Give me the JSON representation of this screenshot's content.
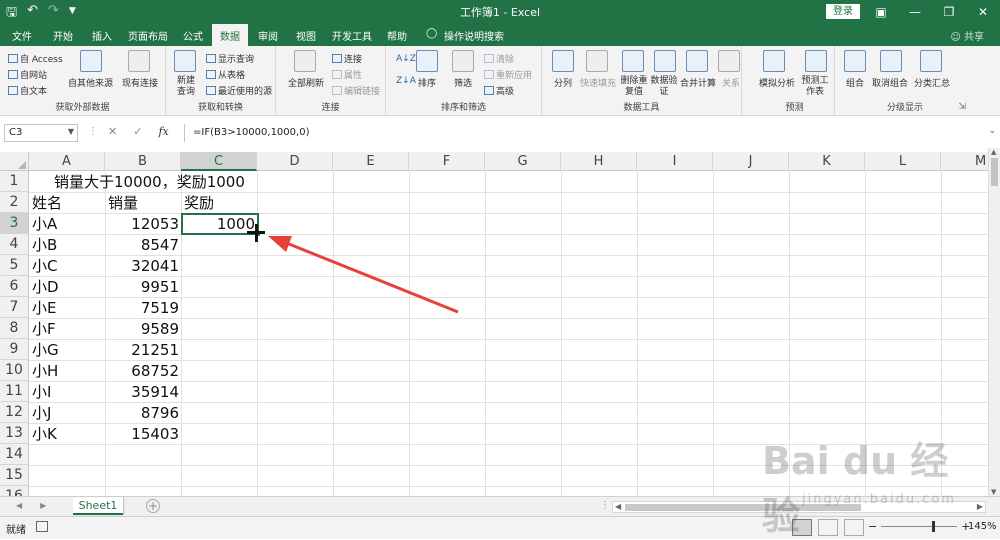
{
  "window": {
    "title": "工作簿1  -  Excel",
    "login": "登录",
    "qat": [
      "save-icon",
      "undo-icon",
      "redo-icon",
      "customize-icon"
    ]
  },
  "menu": {
    "tabs": [
      "文件",
      "开始",
      "插入",
      "页面布局",
      "公式",
      "数据",
      "审阅",
      "视图",
      "开发工具",
      "帮助"
    ],
    "active": "数据",
    "tellme": "操作说明搜索",
    "share": "共享"
  },
  "ribbon": {
    "get_external": {
      "label": "获取外部数据",
      "access": "自 Access",
      "web": "自网站",
      "text": "自文本",
      "other": "自其他来源",
      "existing": "现有连接"
    },
    "get_transform": {
      "label": "获取和转换",
      "new_query": "新建查询",
      "show_queries": "显示查询",
      "from_table": "从表格",
      "recent_sources": "最近使用的源"
    },
    "connections": {
      "label": "连接",
      "refresh_all": "全部刷新",
      "connections": "连接",
      "properties": "属性",
      "edit_links": "编辑链接"
    },
    "sort_filter": {
      "label": "排序和筛选",
      "sort": "排序",
      "filter": "筛选",
      "clear": "清除",
      "reapply": "重新应用",
      "advanced": "高级"
    },
    "data_tools": {
      "label": "数据工具",
      "text_to_columns": "分列",
      "flash_fill": "快速填充",
      "remove_duplicates": "删除重复值",
      "data_validation": "数据验证",
      "consolidate": "合并计算",
      "relationships": "关系"
    },
    "forecast": {
      "label": "预测",
      "what_if": "模拟分析",
      "forecast_sheet": "预测工作表"
    },
    "outline": {
      "label": "分级显示",
      "group": "组合",
      "ungroup": "取消组合",
      "subtotal": "分类汇总"
    }
  },
  "formula_bar": {
    "name_box": "C3",
    "formula": "=IF(B3>10000,1000,0)"
  },
  "columns": [
    "A",
    "B",
    "C",
    "D",
    "E",
    "F",
    "G",
    "H",
    "I",
    "J",
    "K",
    "L",
    "M"
  ],
  "rows": [
    "1",
    "2",
    "3",
    "4",
    "5",
    "6",
    "7",
    "8",
    "9",
    "10",
    "11",
    "12",
    "13",
    "14",
    "15",
    "16"
  ],
  "cells": {
    "title": "销量大于10000，奖励1000",
    "headers": [
      "姓名",
      "销量",
      "奖励"
    ],
    "names": [
      "小A",
      "小B",
      "小C",
      "小D",
      "小E",
      "小F",
      "小G",
      "小H",
      "小I",
      "小J",
      "小K"
    ],
    "sales": [
      "12053",
      "8547",
      "32041",
      "9951",
      "7519",
      "9589",
      "21251",
      "68752",
      "35914",
      "8796",
      "15403"
    ],
    "reward_c3": "1000"
  },
  "sheets": [
    "Sheet1"
  ],
  "status": {
    "ready": "就绪",
    "zoom": "145%"
  },
  "watermark": {
    "brand": "Bai  du 经验",
    "url": "jingyan.baidu.com"
  },
  "colors": {
    "excel_green": "#217346",
    "annotation_arrow": "#e8413a"
  }
}
